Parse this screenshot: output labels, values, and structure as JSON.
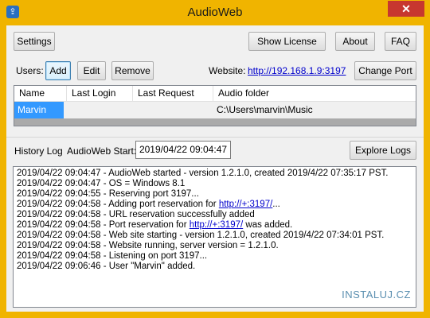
{
  "window": {
    "title": "AudioWeb",
    "close_glyph": "✕",
    "app_icon": "audioweb-app-icon"
  },
  "toolbar": {
    "settings_label": "Settings",
    "show_license_label": "Show License",
    "about_label": "About",
    "faq_label": "FAQ"
  },
  "users": {
    "label": "Users:",
    "add_label": "Add",
    "edit_label": "Edit",
    "remove_label": "Remove",
    "website_label": "Website:",
    "website_link": "http://192.168.1.9:3197",
    "change_port_label": "Change Port",
    "columns": [
      "Name",
      "Last Login",
      "Last Request",
      "Audio folder"
    ],
    "rows": [
      {
        "name": "Marvin",
        "last_login": "",
        "last_request": "",
        "audio_folder": "C:\\Users\\marvin\\Music"
      }
    ]
  },
  "history": {
    "label": "History Log",
    "start_label": "AudioWeb Start:",
    "start_value": "2019/04/22 09:04:47",
    "explore_logs_label": "Explore Logs",
    "lines": [
      {
        "text": "2019/04/22 09:04:47 - AudioWeb started - version 1.2.1.0, created 2019/4/22 07:35:17 PST."
      },
      {
        "text": "2019/04/22 09:04:47 - OS = Windows 8.1"
      },
      {
        "text": "2019/04/22 09:04:55 - Reserving port 3197..."
      },
      {
        "pre": "2019/04/22 09:04:58 - Adding port reservation for ",
        "link": "http://+:3197/",
        "post": "..."
      },
      {
        "text": "2019/04/22 09:04:58 - URL reservation successfully added"
      },
      {
        "pre": "2019/04/22 09:04:58 - Port reservation for ",
        "link": "http://+:3197/",
        "post": " was added."
      },
      {
        "text": "2019/04/22 09:04:58 - Web site starting - version 1.2.1.0, created 2019/4/22 07:34:01 PST."
      },
      {
        "text": "2019/04/22 09:04:58 - Website running, server version = 1.2.1.0."
      },
      {
        "text": "2019/04/22 09:04:58 - Listening on port 3197..."
      },
      {
        "text": "2019/04/22 09:06:46 - User \"Marvin\" added."
      }
    ]
  },
  "watermark": {
    "text": "INSTALUJ.CZ"
  }
}
